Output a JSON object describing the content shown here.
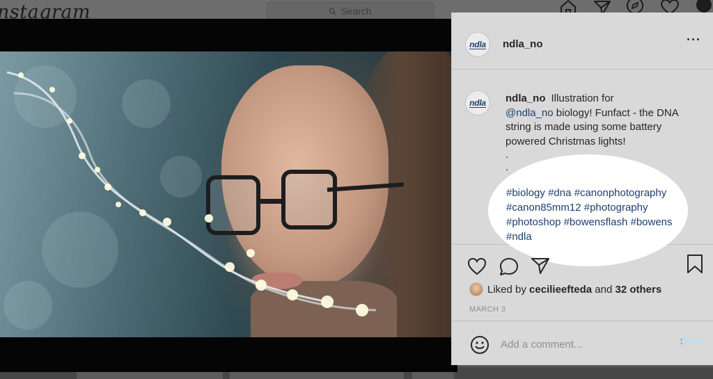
{
  "app": {
    "logo_text": "nstagram",
    "search_placeholder": "Search",
    "nav_icons": [
      "home-icon",
      "direct-icon",
      "explore-icon",
      "activity-icon",
      "profile-icon"
    ]
  },
  "post": {
    "header": {
      "avatar_text": "ndla",
      "username": "ndla_no",
      "more_label": "···"
    },
    "caption": {
      "username": "ndla_no",
      "text_before_mention": "Illustration for",
      "mention": "@ndla_no",
      "text_after_mention": " biology! Funfact - the DNA string is made using some battery powered Christmas lights!",
      "dots": [
        ".",
        "."
      ],
      "hashtags": [
        "#biology",
        "#dna",
        "#canonphotography",
        "#canon85mm12",
        "#photography",
        "#photoshop",
        "#bowensflash",
        "#bowens",
        "#ndla"
      ]
    },
    "actions": [
      "like-icon",
      "comment-icon",
      "share-icon",
      "save-icon"
    ],
    "likes": {
      "prefix": "Liked by",
      "user": "cecilieefteda",
      "joiner": "and",
      "others": "32 others"
    },
    "date": "MARCH 3",
    "comment": {
      "placeholder": "Add a comment...",
      "emoji_icon": "emoji-icon",
      "post_label": "Post"
    }
  },
  "colors": {
    "accent_link": "#1d3f6e",
    "post_button_disabled": "#b2dffc",
    "panel_bg": "#d9d9d9",
    "highlight": "#ffffff"
  }
}
